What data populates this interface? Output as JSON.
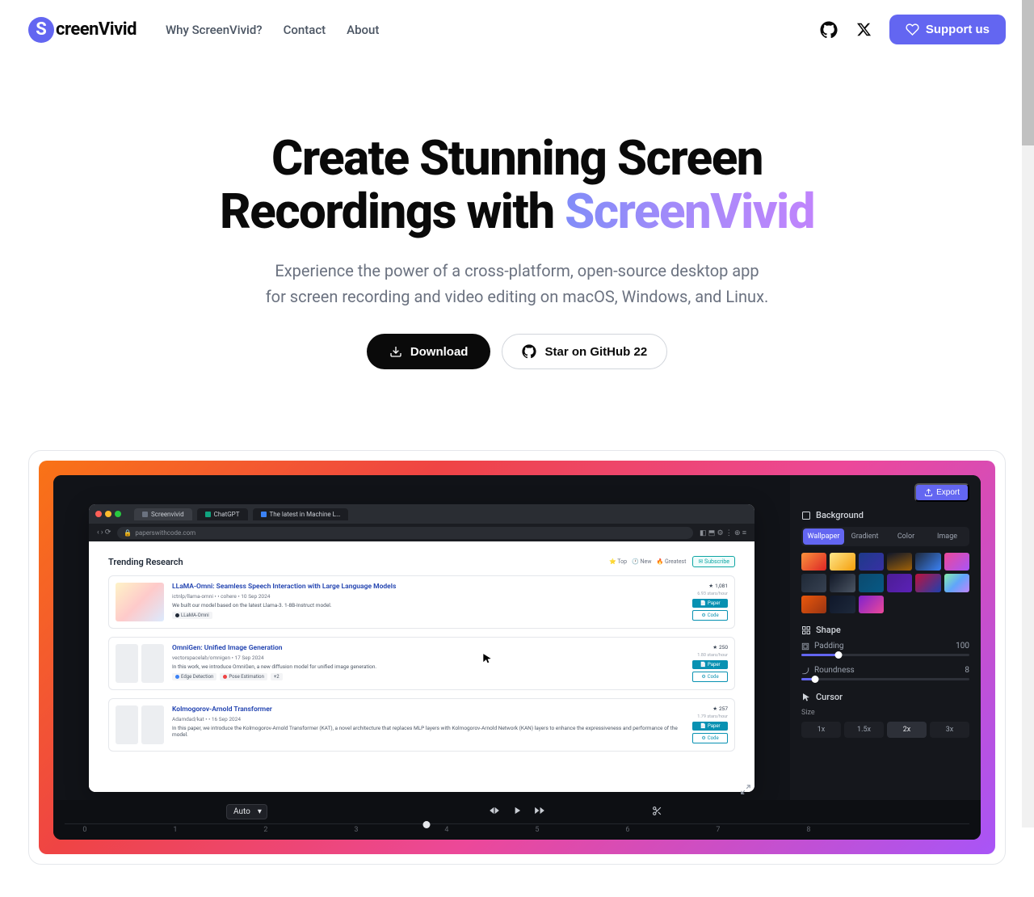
{
  "brand": {
    "initial": "S",
    "name": "creenVivid"
  },
  "nav": {
    "why": "Why ScreenVivid?",
    "contact": "Contact",
    "about": "About"
  },
  "cta": {
    "support": "Support us"
  },
  "hero": {
    "title_line1": "Create Stunning Screen",
    "title_line2_a": "Recordings with ",
    "title_line2_b": "ScreenVivid",
    "sub1": "Experience the power of a cross-platform, open-source desktop app",
    "sub2": "for screen recording and video editing on macOS, Windows, and Linux.",
    "download": "Download",
    "star_prefix": "Star on GitHub ",
    "star_count": "22"
  },
  "app": {
    "export": "Export",
    "panel": {
      "background_h": "Background",
      "bg_tabs": {
        "wallpaper": "Wallpaper",
        "gradient": "Gradient",
        "color": "Color",
        "image": "Image"
      },
      "shape_h": "Shape",
      "padding_label": "Padding",
      "padding_value": "100",
      "roundness_label": "Roundness",
      "roundness_value": "8",
      "cursor_h": "Cursor",
      "size_label": "Size",
      "seg": {
        "x1": "1x",
        "x15": "1.5x",
        "x2": "2x",
        "x3": "3x"
      }
    },
    "timeline": {
      "speed": "Auto",
      "ticks": [
        "0",
        "1",
        "2",
        "3",
        "4",
        "5",
        "6",
        "7",
        "8"
      ]
    },
    "browser": {
      "tabs": {
        "t1": "Screenvivid",
        "t2": "ChatGPT",
        "t3": "The latest in Machine L…"
      },
      "url": "paperswithcode.com",
      "trending": "Trending Research",
      "subscribe": "Subscribe",
      "filters": {
        "top": "Top",
        "new": "New",
        "greatest": "Greatest"
      },
      "papers": [
        {
          "title": "LLaMA-Omni: Seamless Speech Interaction with Large Language Models",
          "meta": "ictnlp/llama-omni • • cohere • 10 Sep 2024",
          "desc": "We built our model based on the latest Llama-3. 1-8B-Instruct model.",
          "tag": "LLaMA-Omni",
          "likes": "1,081",
          "sub": "6.93 stars/hour",
          "btn1": "Paper",
          "btn2": "Code"
        },
        {
          "title": "OmniGen: Unified Image Generation",
          "meta": "vectorspacelab/omnigen • 17 Sep 2024",
          "desc": "In this work, we introduce OmniGen, a new diffusion model for unified image generation.",
          "tags": [
            "Edge Detection",
            "Pose Estimation",
            "+2"
          ],
          "likes": "250",
          "sub": "1.80 stars/hour",
          "btn1": "Paper",
          "btn2": "Code"
        },
        {
          "title": "Kolmogorov-Arnold Transformer",
          "meta": "Adamdad/kat • • 16 Sep 2024",
          "desc": "In this paper, we introduce the Kolmogorov-Arnold Transformer (KAT), a novel architecture that replaces MLP layers with Kolmogorov-Arnold Network (KAN) layers to enhance the expressiveness and performance of the model.",
          "likes": "257",
          "sub": "1.79 stars/hour",
          "btn1": "Paper",
          "btn2": "Code"
        }
      ]
    }
  }
}
